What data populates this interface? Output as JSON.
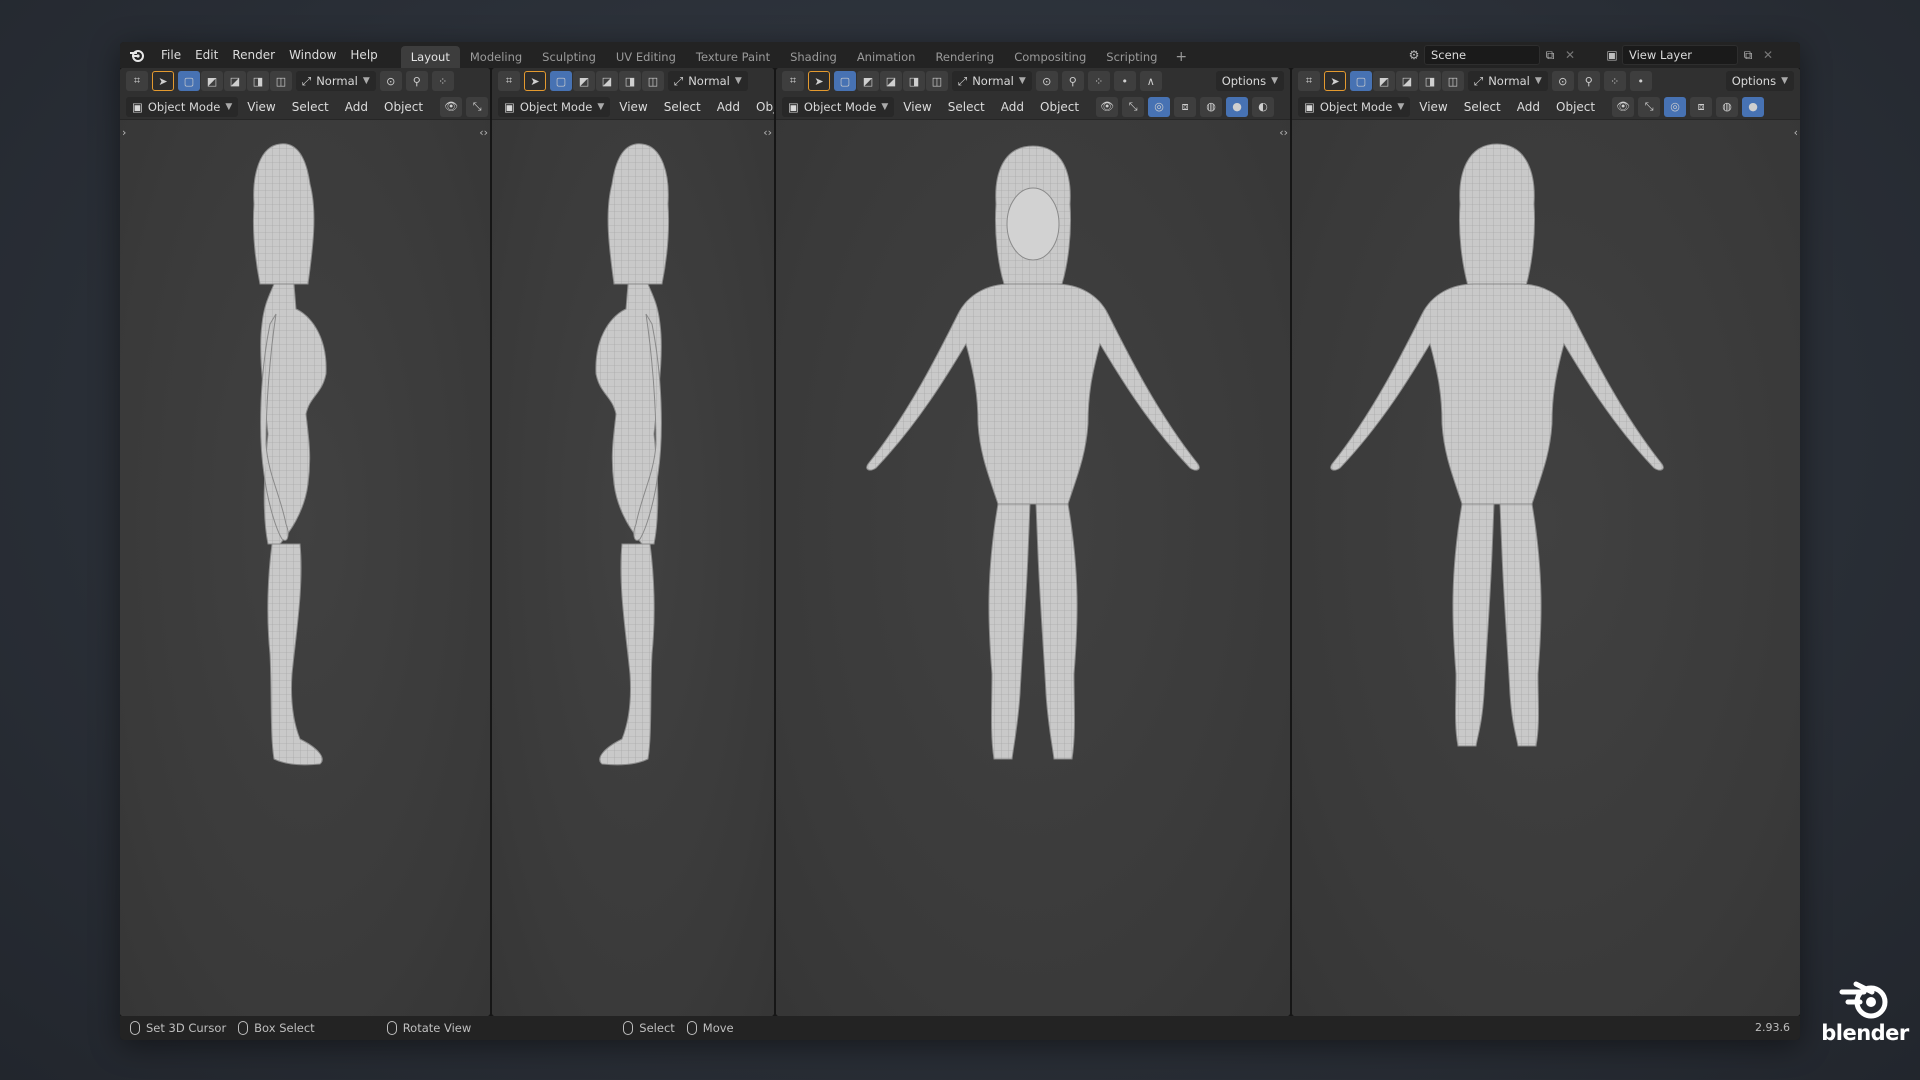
{
  "topbar": {
    "menus": [
      "File",
      "Edit",
      "Render",
      "Window",
      "Help"
    ],
    "workspace_tabs": [
      {
        "label": "Layout",
        "active": true
      },
      {
        "label": "Modeling",
        "active": false
      },
      {
        "label": "Sculpting",
        "active": false
      },
      {
        "label": "UV Editing",
        "active": false
      },
      {
        "label": "Texture Paint",
        "active": false
      },
      {
        "label": "Shading",
        "active": false
      },
      {
        "label": "Animation",
        "active": false
      },
      {
        "label": "Rendering",
        "active": false
      },
      {
        "label": "Compositing",
        "active": false
      },
      {
        "label": "Scripting",
        "active": false
      }
    ],
    "add_workspace_icon": "plus-icon",
    "scene": "Scene",
    "view_layer": "View Layer"
  },
  "viewports": [
    {
      "id": "left-view",
      "transform_orientation": "Normal",
      "mode": "Object Mode",
      "menus": [
        "View",
        "Select",
        "Add",
        "Object"
      ],
      "options_label": "",
      "view": "side-facing-right"
    },
    {
      "id": "right-view",
      "transform_orientation": "Normal",
      "mode": "Object Mode",
      "menus": [
        "View",
        "Select",
        "Add",
        "Object"
      ],
      "options_label": "",
      "view": "side-facing-left"
    },
    {
      "id": "front-view",
      "transform_orientation": "Normal",
      "mode": "Object Mode",
      "menus": [
        "View",
        "Select",
        "Add",
        "Object"
      ],
      "options_label": "Options",
      "view": "front"
    },
    {
      "id": "back-view",
      "transform_orientation": "Normal",
      "mode": "Object Mode",
      "menus": [
        "View",
        "Select",
        "Add",
        "Object"
      ],
      "options_label": "Options",
      "view": "back"
    }
  ],
  "statusbar": {
    "items": [
      "Set 3D Cursor",
      "Box Select",
      "Rotate View",
      "Select",
      "Move"
    ],
    "version": "2.93.6"
  },
  "brand": {
    "wordmark": "blender"
  },
  "colors": {
    "accent": "#4772b3",
    "active_tool_outline": "#e49a2f",
    "viewport_bg": "#3b3b3b",
    "header_bg": "#303030"
  }
}
